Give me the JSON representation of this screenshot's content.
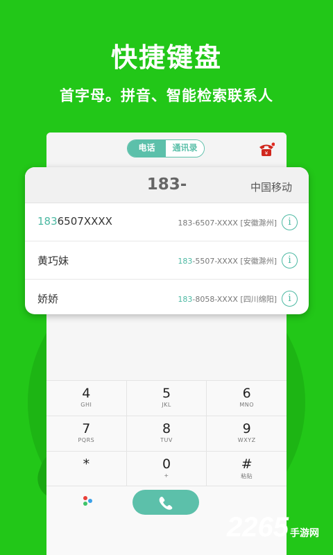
{
  "promo": {
    "headline": "快捷键盘",
    "subline": "首字母。拼音、智能检索联系人"
  },
  "topbar": {
    "tabs": [
      {
        "label": "电话",
        "active": true
      },
      {
        "label": "通讯录",
        "active": false
      }
    ],
    "right_icon": "telephone-icon"
  },
  "search_card": {
    "typed_number": "183-",
    "carrier": "中国移动",
    "results": [
      {
        "name_highlight": "183",
        "name_rest": "6507XXXX",
        "detail_highlight": "",
        "detail_rest": "183-6507-XXXX [安徽滁州]"
      },
      {
        "name_highlight": "",
        "name_rest": "黄巧妹",
        "detail_highlight": "183",
        "detail_rest": "-5507-XXXX [安徽滁州]"
      },
      {
        "name_highlight": "",
        "name_rest": "娇娇",
        "detail_highlight": "183",
        "detail_rest": "-8058-XXXX [四川绵阳]"
      }
    ]
  },
  "keypad": {
    "rows": [
      [
        {
          "digit": "4",
          "letters": "GHI"
        },
        {
          "digit": "5",
          "letters": "JKL"
        },
        {
          "digit": "6",
          "letters": "MNO"
        }
      ],
      [
        {
          "digit": "7",
          "letters": "PQRS"
        },
        {
          "digit": "8",
          "letters": "TUV"
        },
        {
          "digit": "9",
          "letters": "WXYZ"
        }
      ],
      [
        {
          "digit": "*",
          "letters": ""
        },
        {
          "digit": "0",
          "letters": "+"
        },
        {
          "digit": "#",
          "letters": "粘贴"
        }
      ]
    ]
  },
  "watermark": {
    "number": "2265",
    "suffix": "手游网"
  },
  "colors": {
    "background": "#22c718",
    "accent": "#5cc0aa"
  }
}
